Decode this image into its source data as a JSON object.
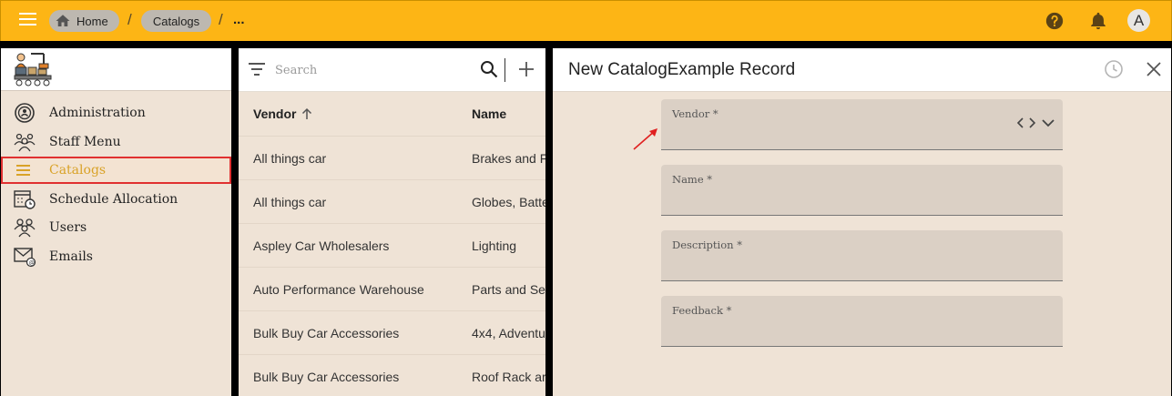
{
  "topbar": {
    "menu_icon": "hamburger-menu-icon",
    "breadcrumbs": [
      {
        "label": "Home",
        "icon": "home-icon"
      },
      {
        "label": "Catalogs"
      }
    ],
    "separator": "/",
    "ellipsis": "...",
    "help_icon": "help-circle-icon",
    "notifications_icon": "bell-icon",
    "avatar_letter": "A",
    "bar_color": "#FDB515"
  },
  "sidebar": {
    "logo_icon": "factory-worker-logo",
    "items": [
      {
        "label": "Administration",
        "icon": "admin-gear-icon"
      },
      {
        "label": "Staff Menu",
        "icon": "staff-group-icon"
      },
      {
        "label": "Catalogs",
        "icon": "list-icon",
        "active": true
      },
      {
        "label": "Schedule Allocation",
        "icon": "calendar-clock-icon"
      },
      {
        "label": "Users",
        "icon": "users-icon"
      },
      {
        "label": "Emails",
        "icon": "email-icon"
      }
    ],
    "active_color": "#d9a227",
    "highlight_border": "#e03030"
  },
  "list": {
    "search_placeholder": "Search",
    "columns": {
      "vendor": "Vendor",
      "name": "Name"
    },
    "rows": [
      {
        "vendor": "All things car",
        "name": "Brakes and F"
      },
      {
        "vendor": "All things car",
        "name": "Globes, Batte"
      },
      {
        "vendor": "Aspley Car Wholesalers",
        "name": "Lighting"
      },
      {
        "vendor": "Auto Performance Warehouse",
        "name": "Parts and Se"
      },
      {
        "vendor": "Bulk Buy Car Accessories",
        "name": "4x4, Adventu"
      },
      {
        "vendor": "Bulk Buy Car Accessories",
        "name": "Roof Rack ar"
      }
    ]
  },
  "form": {
    "title": "New CatalogExample Record",
    "fields": [
      {
        "label": "Vendor *",
        "value": ""
      },
      {
        "label": "Name *",
        "value": ""
      },
      {
        "label": "Description *",
        "value": ""
      },
      {
        "label": "Feedback *",
        "value": ""
      }
    ],
    "annotation_arrow_color": "#e02020"
  }
}
